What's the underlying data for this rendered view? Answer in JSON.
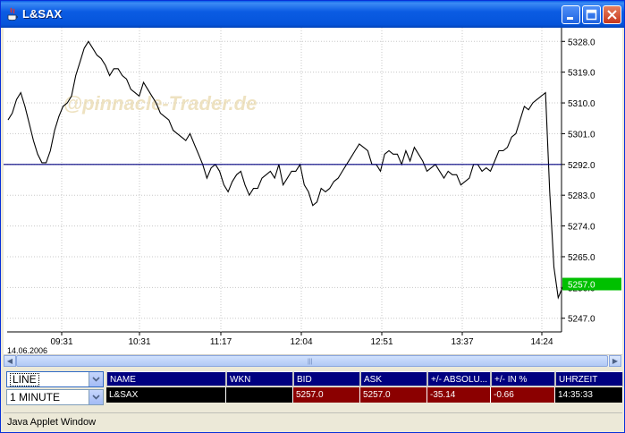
{
  "window": {
    "title": "L&SAX",
    "status": "Java Applet Window"
  },
  "chart": {
    "watermark": "@pinnacle-Trader.de",
    "date_label": "14.06.2006",
    "current_price_label": "5257.0",
    "reference_line": 5292.0
  },
  "chart_data": {
    "type": "line",
    "ylim": [
      5243,
      5332
    ],
    "y_ticks": [
      "5328.0",
      "5319.0",
      "5310.0",
      "5301.0",
      "5292.0",
      "5283.0",
      "5274.0",
      "5265.0",
      "5256.0",
      "5247.0"
    ],
    "x_ticks": [
      "09:31",
      "10:31",
      "11:17",
      "12:04",
      "12:51",
      "13:37",
      "14:24"
    ],
    "series": [
      {
        "values": [
          5305,
          5307,
          5311,
          5313,
          5309,
          5304,
          5299,
          5295,
          5292.5,
          5292.5,
          5296,
          5302,
          5306,
          5309,
          5310,
          5312,
          5318,
          5322,
          5326,
          5328,
          5326,
          5324,
          5323,
          5321,
          5318,
          5320,
          5320,
          5318,
          5317,
          5314,
          5313,
          5312,
          5316,
          5314,
          5312,
          5310,
          5307,
          5306,
          5305,
          5302,
          5301,
          5300,
          5299,
          5301,
          5298,
          5295,
          5292,
          5288,
          5291,
          5292,
          5290,
          5286,
          5284,
          5287,
          5289,
          5290,
          5286,
          5283,
          5285,
          5285,
          5288,
          5289,
          5290,
          5288,
          5292,
          5286,
          5288,
          5290,
          5290,
          5292,
          5286,
          5284,
          5280,
          5281,
          5285,
          5284,
          5285,
          5287,
          5288,
          5290,
          5292,
          5294,
          5296,
          5298,
          5297,
          5296,
          5292,
          5292,
          5290,
          5295,
          5296,
          5295,
          5295,
          5292,
          5296,
          5293,
          5297,
          5295,
          5293,
          5290,
          5291,
          5292,
          5290,
          5288,
          5290,
          5289,
          5289,
          5286,
          5287,
          5288,
          5292,
          5292,
          5290,
          5291,
          5290,
          5293,
          5296,
          5296,
          5297,
          5300,
          5301,
          5305,
          5309,
          5308,
          5310,
          5311,
          5312,
          5313,
          5284,
          5262,
          5253,
          5256
        ]
      }
    ]
  },
  "controls": {
    "chart_type": "LINE",
    "interval": "1 MINUTE"
  },
  "table": {
    "headers": [
      "NAME",
      "WKN",
      "BID",
      "ASK",
      "+/- ABSOLU...",
      "+/- IN %",
      "UHRZEIT"
    ],
    "row": [
      "L&SAX",
      "",
      "5257.0",
      "5257.0",
      "-35.14",
      "-0.66",
      "14:35:33"
    ]
  },
  "colors": {
    "line": "#000000",
    "reference_line": "#000080",
    "price_tag": "#00c000",
    "header_bg": "#000080",
    "negative_bg": "#8b0000"
  }
}
